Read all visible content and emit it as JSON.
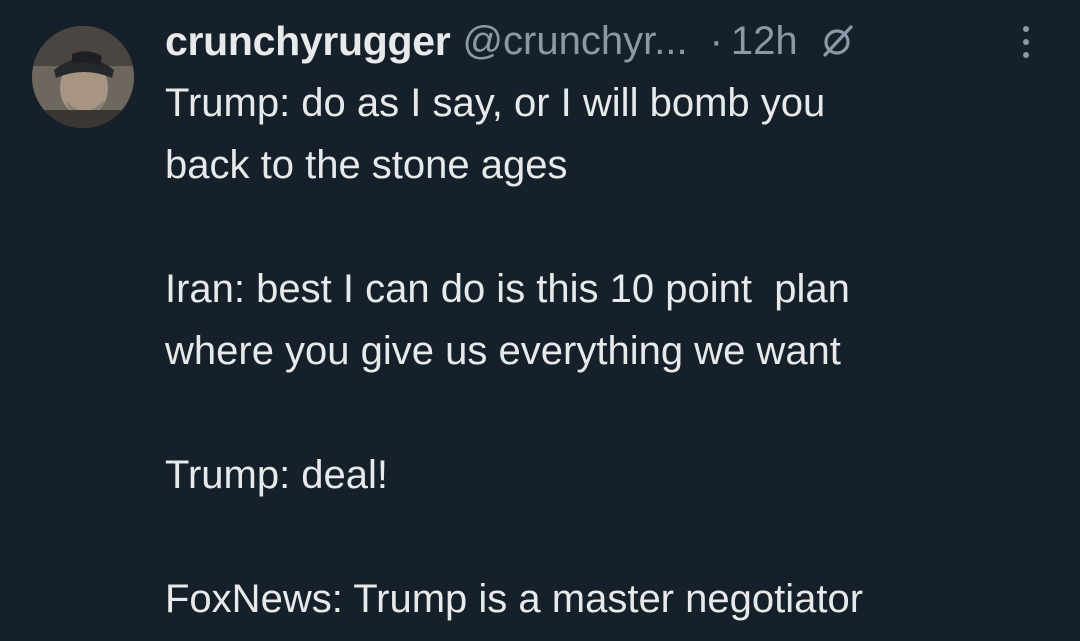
{
  "tweet": {
    "avatar_icon": "user-avatar",
    "display_name": "crunchyrugger",
    "handle": "@crunchyr...",
    "separator": "·",
    "time": "12h",
    "grok_icon": "grok-icon",
    "more_icon": "more-vertical-icon",
    "lines": [
      "Trump: do as I say, or I will bomb you",
      "back to the stone ages",
      "Iran: best I can do is this 10 point  plan",
      "where you give us everything we want",
      "Trump: deal!",
      "FoxNews: Trump is a master negotiator"
    ]
  },
  "colors": {
    "background": "#15202b",
    "primary_text": "#e7e9ea",
    "secondary_text": "#8b98a5"
  }
}
